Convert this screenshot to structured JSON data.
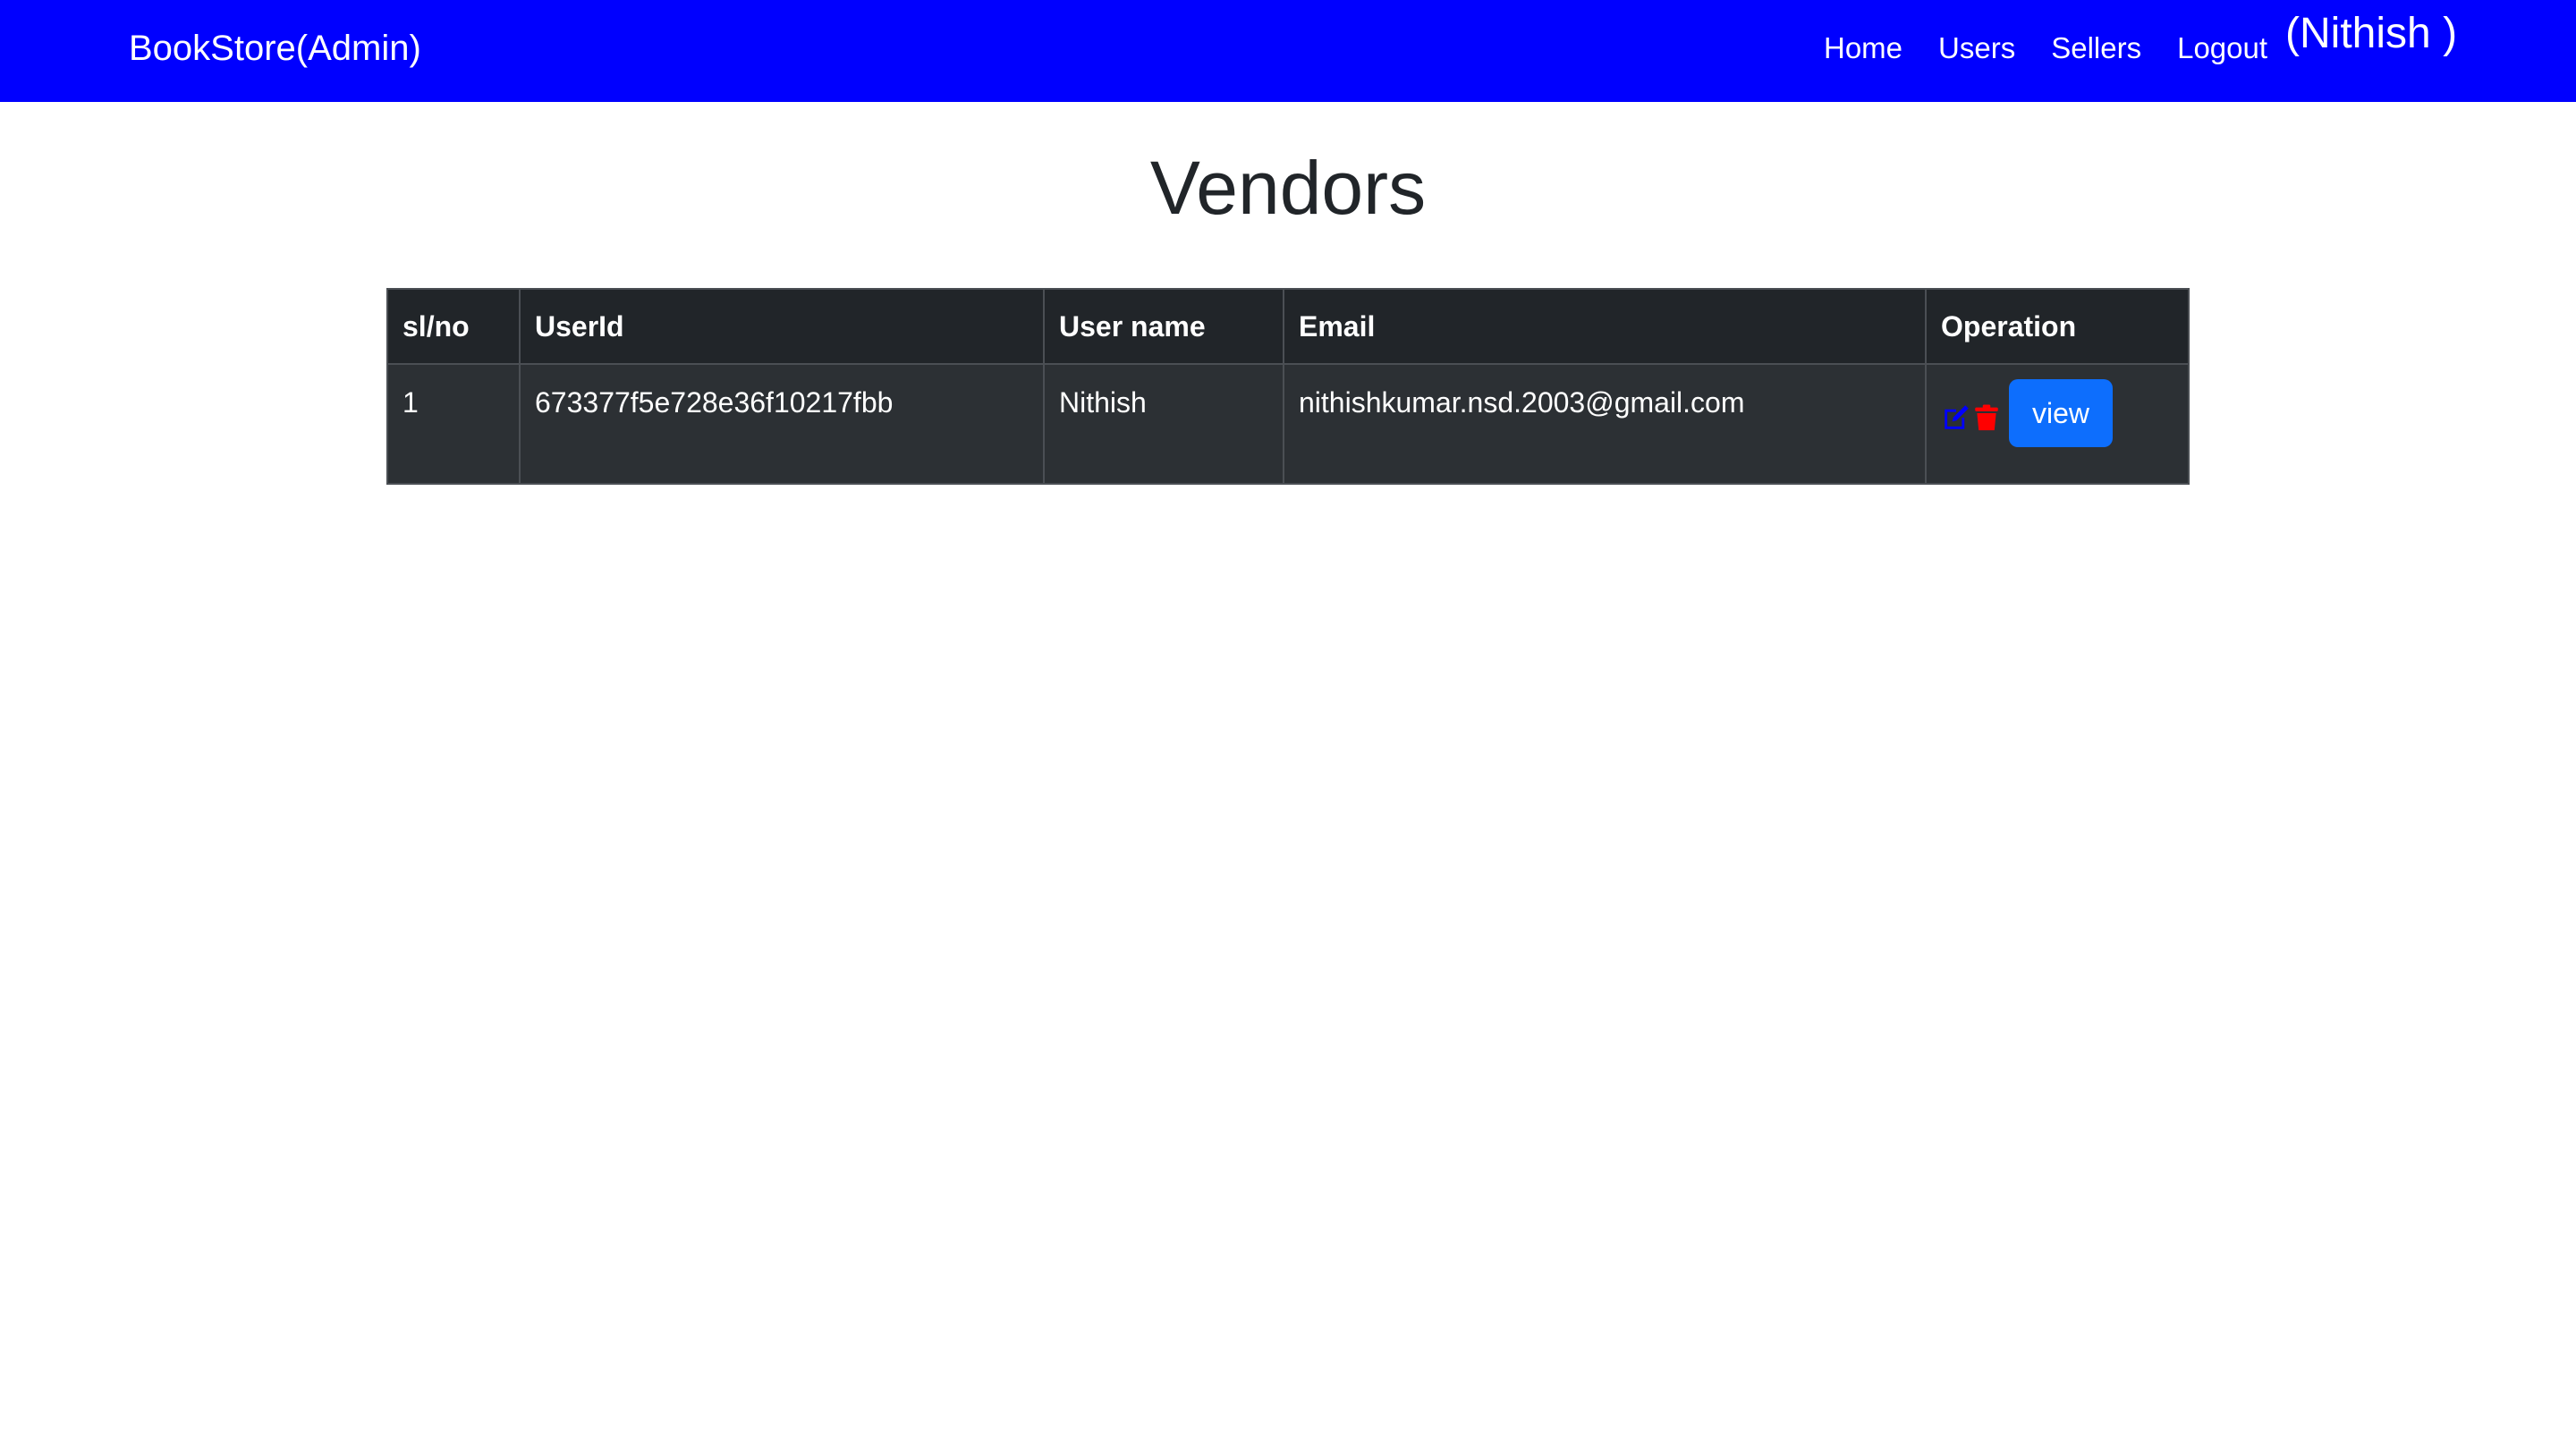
{
  "navbar": {
    "brand": "BookStore(Admin)",
    "links": [
      "Home",
      "Users",
      "Sellers",
      "Logout"
    ],
    "user": "(Nithish )",
    "background_color": "#0000ff"
  },
  "page": {
    "title": "Vendors"
  },
  "table": {
    "headers": [
      "sl/no",
      "UserId",
      "User name",
      "Email",
      "Operation"
    ],
    "rows": [
      {
        "sl": "1",
        "user_id": "673377f5e728e36f10217fbb",
        "user_name": "Nithish",
        "email": "nithishkumar.nsd.2003@gmail.com",
        "operations": {
          "edit_icon": "edit-icon",
          "delete_icon": "trash-icon",
          "view_label": "view"
        }
      }
    ]
  },
  "colors": {
    "edit_icon": "#0000ff",
    "delete_icon": "#ff0000",
    "view_button": "#0d6efd",
    "table_header_bg": "#212529",
    "table_row_bg": "#2c3034"
  }
}
